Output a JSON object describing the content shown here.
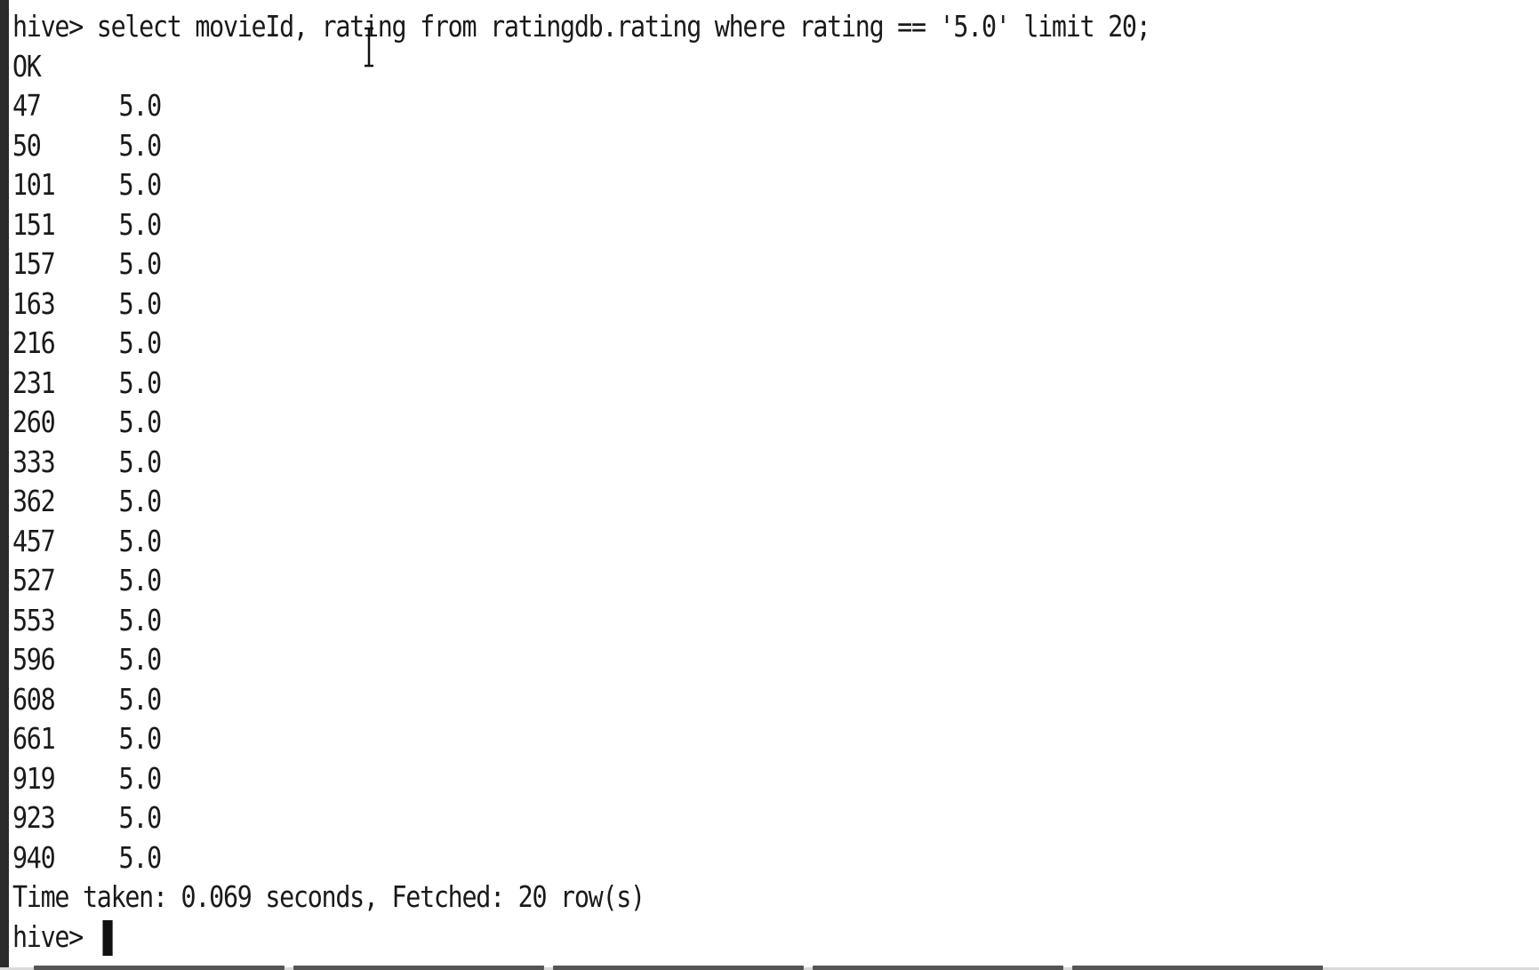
{
  "terminal": {
    "command_line": "hive> select movieId, rating from ratingdb.rating where rating == '5.0' limit 20;",
    "status": "OK",
    "rows": [
      {
        "id": "47",
        "rating": "5.0"
      },
      {
        "id": "50",
        "rating": "5.0"
      },
      {
        "id": "101",
        "rating": "5.0"
      },
      {
        "id": "151",
        "rating": "5.0"
      },
      {
        "id": "157",
        "rating": "5.0"
      },
      {
        "id": "163",
        "rating": "5.0"
      },
      {
        "id": "216",
        "rating": "5.0"
      },
      {
        "id": "231",
        "rating": "5.0"
      },
      {
        "id": "260",
        "rating": "5.0"
      },
      {
        "id": "333",
        "rating": "5.0"
      },
      {
        "id": "362",
        "rating": "5.0"
      },
      {
        "id": "457",
        "rating": "5.0"
      },
      {
        "id": "527",
        "rating": "5.0"
      },
      {
        "id": "553",
        "rating": "5.0"
      },
      {
        "id": "596",
        "rating": "5.0"
      },
      {
        "id": "608",
        "rating": "5.0"
      },
      {
        "id": "661",
        "rating": "5.0"
      },
      {
        "id": "919",
        "rating": "5.0"
      },
      {
        "id": "923",
        "rating": "5.0"
      },
      {
        "id": "940",
        "rating": "5.0"
      }
    ],
    "summary": "Time taken: 0.069 seconds, Fetched: 20 row(s)",
    "prompt": "hive> "
  },
  "icons": {
    "mouse_pointer": "i-beam-cursor-icon",
    "text_cursor": "block-cursor-icon"
  }
}
